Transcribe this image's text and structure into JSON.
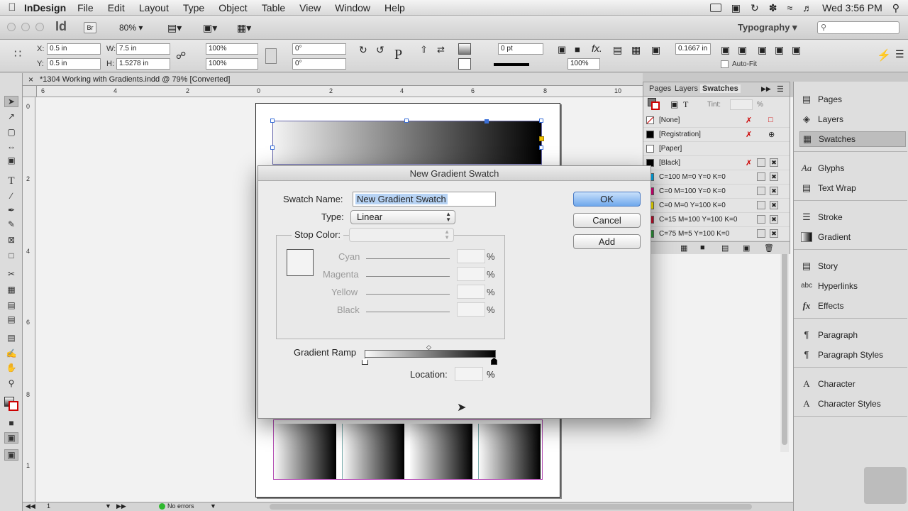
{
  "menubar": {
    "app": "InDesign",
    "menus": [
      "File",
      "Edit",
      "Layout",
      "Type",
      "Object",
      "Table",
      "View",
      "Window",
      "Help"
    ],
    "clock": "Wed 3:56 PM"
  },
  "appbar": {
    "logo": "Id",
    "bridge": "Br",
    "zoom": "80%",
    "workspace": "Typography"
  },
  "control": {
    "x_label": "X:",
    "x_value": "0.5 in",
    "y_label": "Y:",
    "y_value": "0.5 in",
    "w_label": "W:",
    "w_value": "7.5 in",
    "h_label": "H:",
    "h_value": "1.5278 in",
    "scale_x": "100%",
    "scale_y": "100%",
    "angle": "0°",
    "shear": "0°",
    "stroke_weight": "0 pt",
    "opacity": "100%",
    "offset": "0.1667 in",
    "autofit": "Auto-Fit"
  },
  "document": {
    "tab_title": "*1304 Working with Gradients.indd @ 79% [Converted]",
    "ruler_h": [
      "6",
      "4",
      "2",
      "0",
      "2",
      "4",
      "6",
      "8",
      "10"
    ],
    "ruler_v": [
      "0",
      "2",
      "4",
      "6",
      "8",
      "1"
    ]
  },
  "status": {
    "page": "1",
    "errors": "No errors"
  },
  "swatches_panel": {
    "tabs": [
      "Pages",
      "Layers",
      "Swatches"
    ],
    "tint_label": "Tint:",
    "tint_unit": "%",
    "items": [
      {
        "name": "[None]",
        "color": "#ffffff"
      },
      {
        "name": "[Registration]",
        "color": "#000000"
      },
      {
        "name": "[Paper]",
        "color": "#ffffff"
      },
      {
        "name": "[Black]",
        "color": "#000000"
      },
      {
        "name": "C=100 M=0 Y=0 K=0",
        "color": "#00a8e8"
      },
      {
        "name": "C=0 M=100 Y=0 K=0",
        "color": "#e6007e"
      },
      {
        "name": "C=0 M=0 Y=100 K=0",
        "color": "#ffed00"
      },
      {
        "name": "C=15 M=100 Y=100 K=0",
        "color": "#c8102e"
      },
      {
        "name": "C=75 M=5 Y=100 K=0",
        "color": "#2e9a3c"
      }
    ]
  },
  "dock": {
    "items": [
      "Pages",
      "Layers",
      "Swatches",
      "Glyphs",
      "Text Wrap",
      "Stroke",
      "Gradient",
      "Story",
      "Hyperlinks",
      "Effects",
      "Paragraph",
      "Paragraph Styles",
      "Character",
      "Character Styles"
    ]
  },
  "dialog": {
    "title": "New Gradient Swatch",
    "swatch_name_label": "Swatch Name:",
    "swatch_name_value": "New Gradient Swatch",
    "type_label": "Type:",
    "type_value": "Linear",
    "stop_color_label": "Stop Color:",
    "channels": [
      "Cyan",
      "Magenta",
      "Yellow",
      "Black"
    ],
    "pct": "%",
    "gradient_ramp_label": "Gradient Ramp",
    "location_label": "Location:",
    "ok": "OK",
    "cancel": "Cancel",
    "add": "Add"
  }
}
